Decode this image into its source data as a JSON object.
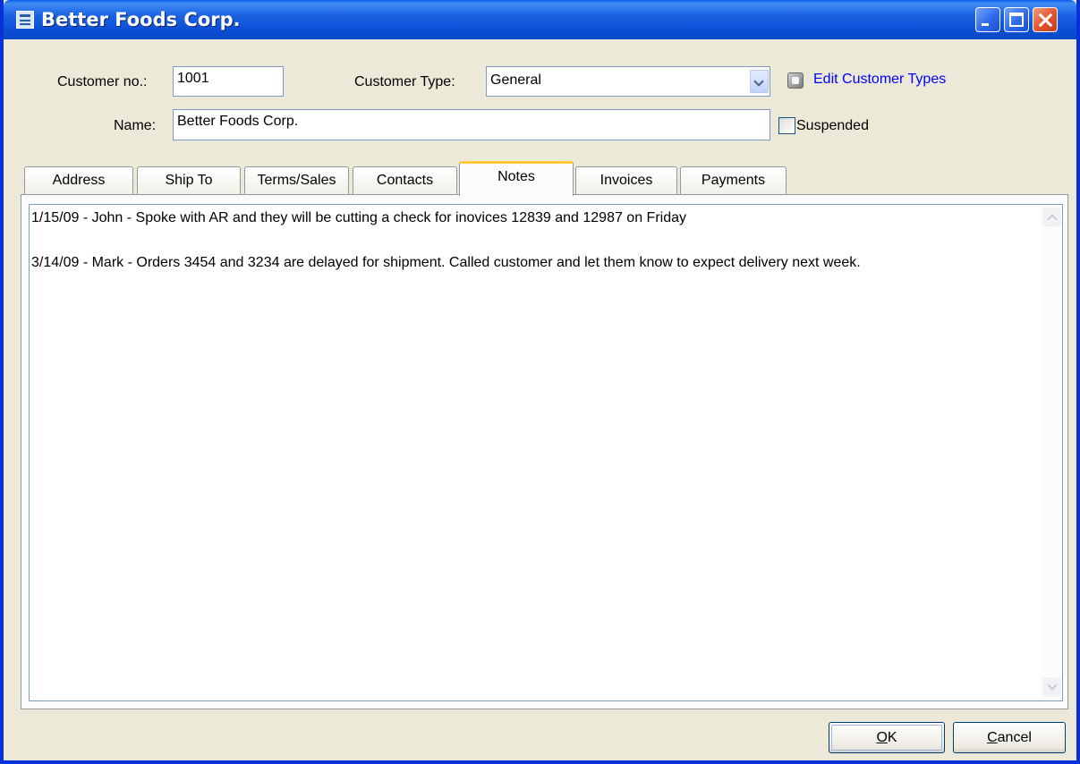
{
  "window": {
    "title": "Better Foods Corp."
  },
  "form": {
    "customer_no_label": "Customer no.:",
    "customer_no_value": "1001",
    "customer_type_label": "Customer Type:",
    "customer_type_value": "General",
    "edit_customer_types_link": "Edit Customer Types",
    "name_label": "Name:",
    "name_value": "Better Foods Corp.",
    "suspended_label": "Suspended",
    "suspended_checked": false
  },
  "tabs": [
    {
      "label": "Address"
    },
    {
      "label": "Ship To"
    },
    {
      "label": "Terms/Sales"
    },
    {
      "label": "Contacts"
    },
    {
      "label": "Notes",
      "active": true
    },
    {
      "label": "Invoices"
    },
    {
      "label": "Payments"
    }
  ],
  "notes": {
    "lines": [
      "1/15/09 - John - Spoke with AR and they will be cutting a check for inovices 12839 and 12987 on Friday",
      "3/14/09 - Mark - Orders 3454 and 3234 are delayed for shipment.  Called customer and let them know to expect delivery next week."
    ]
  },
  "buttons": {
    "ok_mnemonic": "O",
    "ok_rest": "K",
    "cancel_mnemonic": "C",
    "cancel_rest": "ancel"
  },
  "colors": {
    "titlebar": "#0a5de8",
    "window_bg": "#ece9d8",
    "link": "#0000ff",
    "active_tab_accent": "#ffc83c"
  }
}
